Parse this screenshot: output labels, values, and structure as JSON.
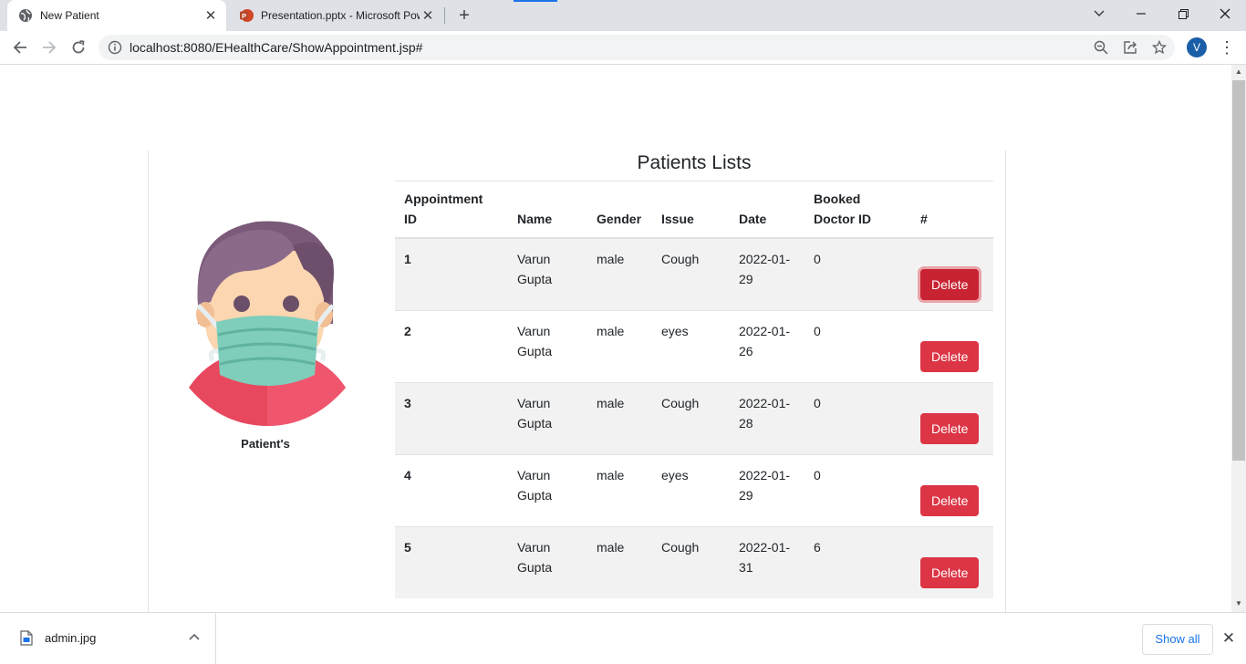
{
  "browser": {
    "tabs": [
      {
        "title": "New Patient",
        "active": true,
        "icon": "globe-icon"
      },
      {
        "title": "Presentation.pptx - Microsoft PowerPoint",
        "active": false,
        "icon": "powerpoint-icon"
      }
    ],
    "url": "localhost:8080/EHealthCare/ShowAppointment.jsp#",
    "profile_initial": "V",
    "accent_color": "#1a73e8"
  },
  "page": {
    "heading": "Patients Lists",
    "avatar_caption": "Patient's",
    "delete_color": "#dc3545",
    "table": {
      "headers": [
        "Appointment ID",
        "Name",
        "Gender",
        "Issue",
        "Date",
        "Booked Doctor ID",
        "#"
      ],
      "rows": [
        {
          "id": "1",
          "name": "Varun Gupta",
          "gender": "male",
          "issue": "Cough",
          "date": "2022-01-29",
          "doctor_id": "0",
          "action": "Delete"
        },
        {
          "id": "2",
          "name": "Varun Gupta",
          "gender": "male",
          "issue": "eyes",
          "date": "2022-01-26",
          "doctor_id": "0",
          "action": "Delete"
        },
        {
          "id": "3",
          "name": "Varun Gupta",
          "gender": "male",
          "issue": "Cough",
          "date": "2022-01-28",
          "doctor_id": "0",
          "action": "Delete"
        },
        {
          "id": "4",
          "name": "Varun Gupta",
          "gender": "male",
          "issue": "eyes",
          "date": "2022-01-29",
          "doctor_id": "0",
          "action": "Delete"
        },
        {
          "id": "5",
          "name": "Varun Gupta",
          "gender": "male",
          "issue": "Cough",
          "date": "2022-01-31",
          "doctor_id": "6",
          "action": "Delete"
        }
      ]
    }
  },
  "downloads": {
    "file_name": "admin.jpg",
    "show_all_label": "Show all"
  }
}
